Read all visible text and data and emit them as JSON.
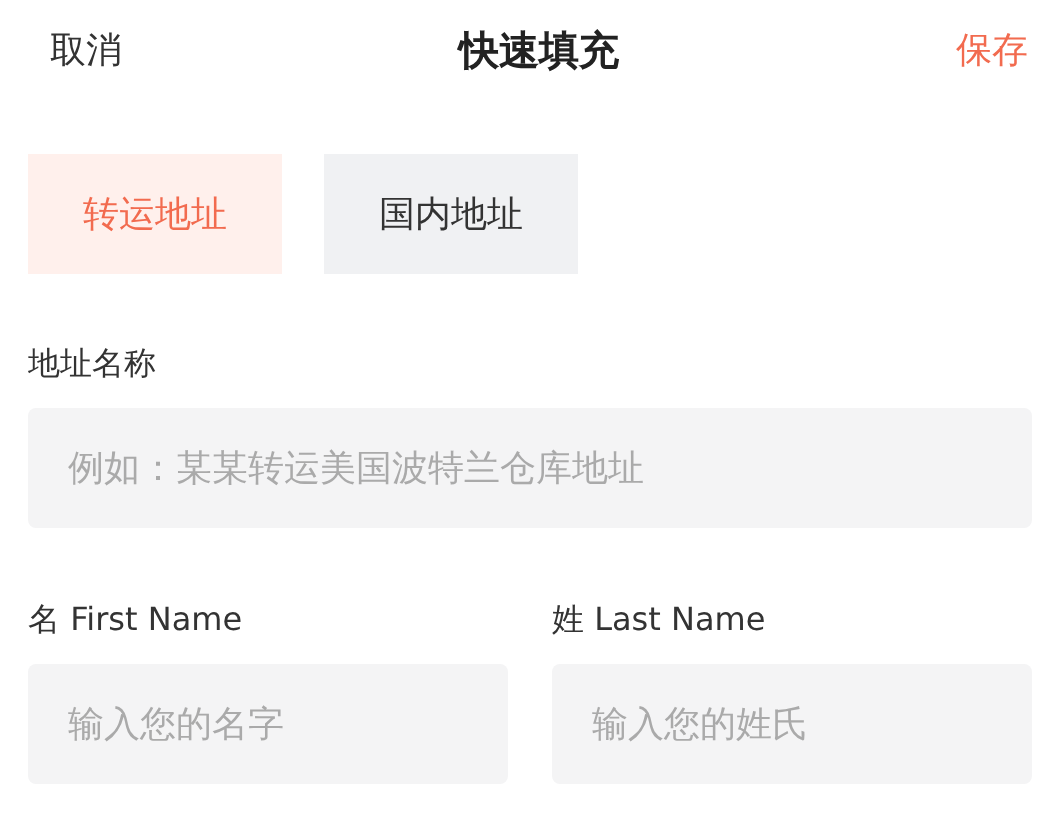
{
  "header": {
    "cancel": "取消",
    "title": "快速填充",
    "save": "保存"
  },
  "tabs": [
    {
      "label": "转运地址",
      "selected": true
    },
    {
      "label": "国内地址",
      "selected": false
    }
  ],
  "address_name": {
    "label": "地址名称",
    "placeholder": "例如：某某转运美国波特兰仓库地址"
  },
  "name_fields": [
    {
      "label": "名 First Name",
      "placeholder": "输入您的名字"
    },
    {
      "label": "姓 Last Name",
      "placeholder": "输入您的姓氏"
    }
  ]
}
